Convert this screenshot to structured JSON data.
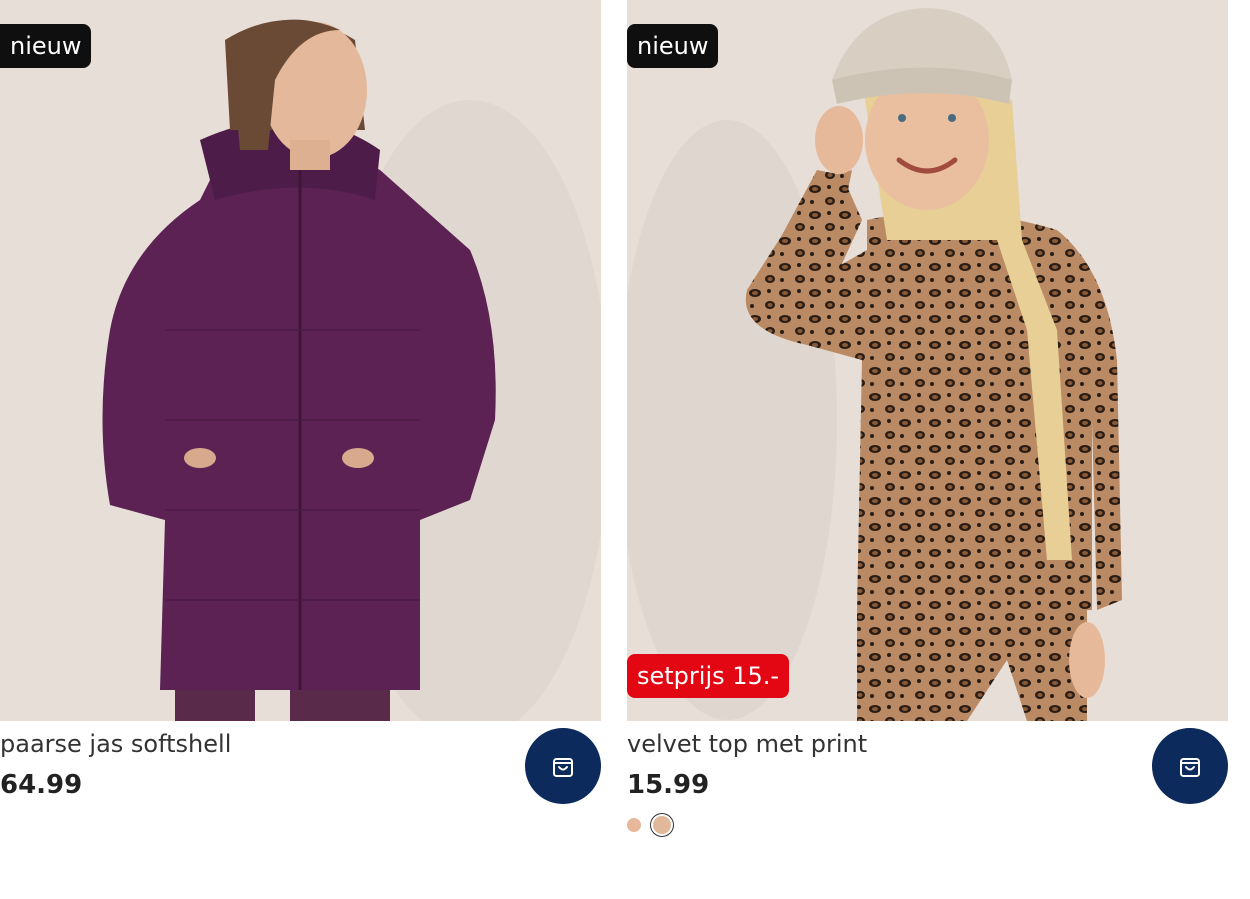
{
  "products": [
    {
      "badge_new": "nieuw",
      "title": "paarse jas softshell",
      "price": "64.99",
      "image_desc": "girl-in-purple-puffer-jacket",
      "cart_icon": "shopping-bag-icon"
    },
    {
      "badge_new": "nieuw",
      "badge_promo": "setprijs 15.-",
      "title": "velvet top met print",
      "price": "15.99",
      "image_desc": "girl-in-leopard-print-top-and-beanie",
      "cart_icon": "shopping-bag-icon",
      "swatches": [
        {
          "color": "#e7b89b",
          "selected": false
        },
        {
          "color": "#e2b89a",
          "selected": true
        }
      ]
    }
  ],
  "colors": {
    "badge_new_bg": "#0f0f0f",
    "badge_promo_bg": "#e30613",
    "cart_button_bg": "#0c2a5b",
    "photo_bg": "#e5ddd6"
  }
}
